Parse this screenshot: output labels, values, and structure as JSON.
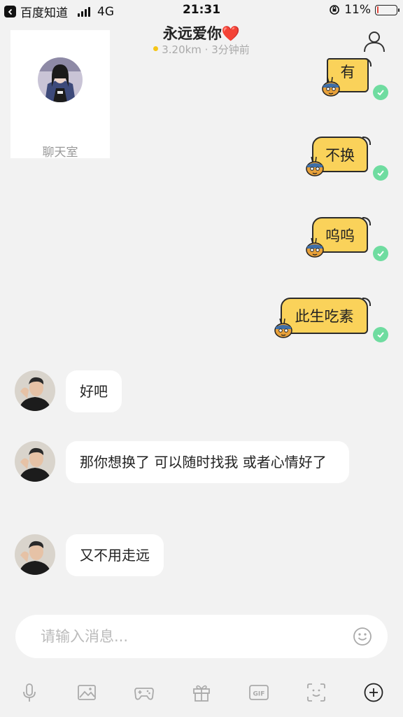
{
  "status_bar": {
    "back_app": "百度知道",
    "network": "4G",
    "time": "21:31",
    "battery": "11%",
    "battery_level": 0.11
  },
  "header": {
    "title": "永远爱你",
    "title_emoji": "❤️",
    "subtitle": "3.20km · 3分钟前",
    "status_dot_color": "#f5c518"
  },
  "chatroom": {
    "label": "聊天室"
  },
  "messages_sent": [
    {
      "text": "有"
    },
    {
      "text": "不换"
    },
    {
      "text": "呜呜"
    },
    {
      "text": "此生吃素"
    }
  ],
  "messages_received": [
    {
      "text": "好吧"
    },
    {
      "text": "那你想换了 可以随时找我 或者心情好了"
    },
    {
      "text": "又不用走远"
    }
  ],
  "input": {
    "placeholder": "请输入消息..."
  },
  "toolbar": {
    "items": [
      "microphone-icon",
      "image-icon",
      "gamepad-icon",
      "gift-icon",
      "gif-icon",
      "face-scan-icon",
      "plus-icon"
    ],
    "gif_label": "GIF"
  },
  "colors": {
    "sticker_yellow": "#fad25a",
    "check_green": "#6fdca0",
    "background": "#f2f2f2"
  }
}
